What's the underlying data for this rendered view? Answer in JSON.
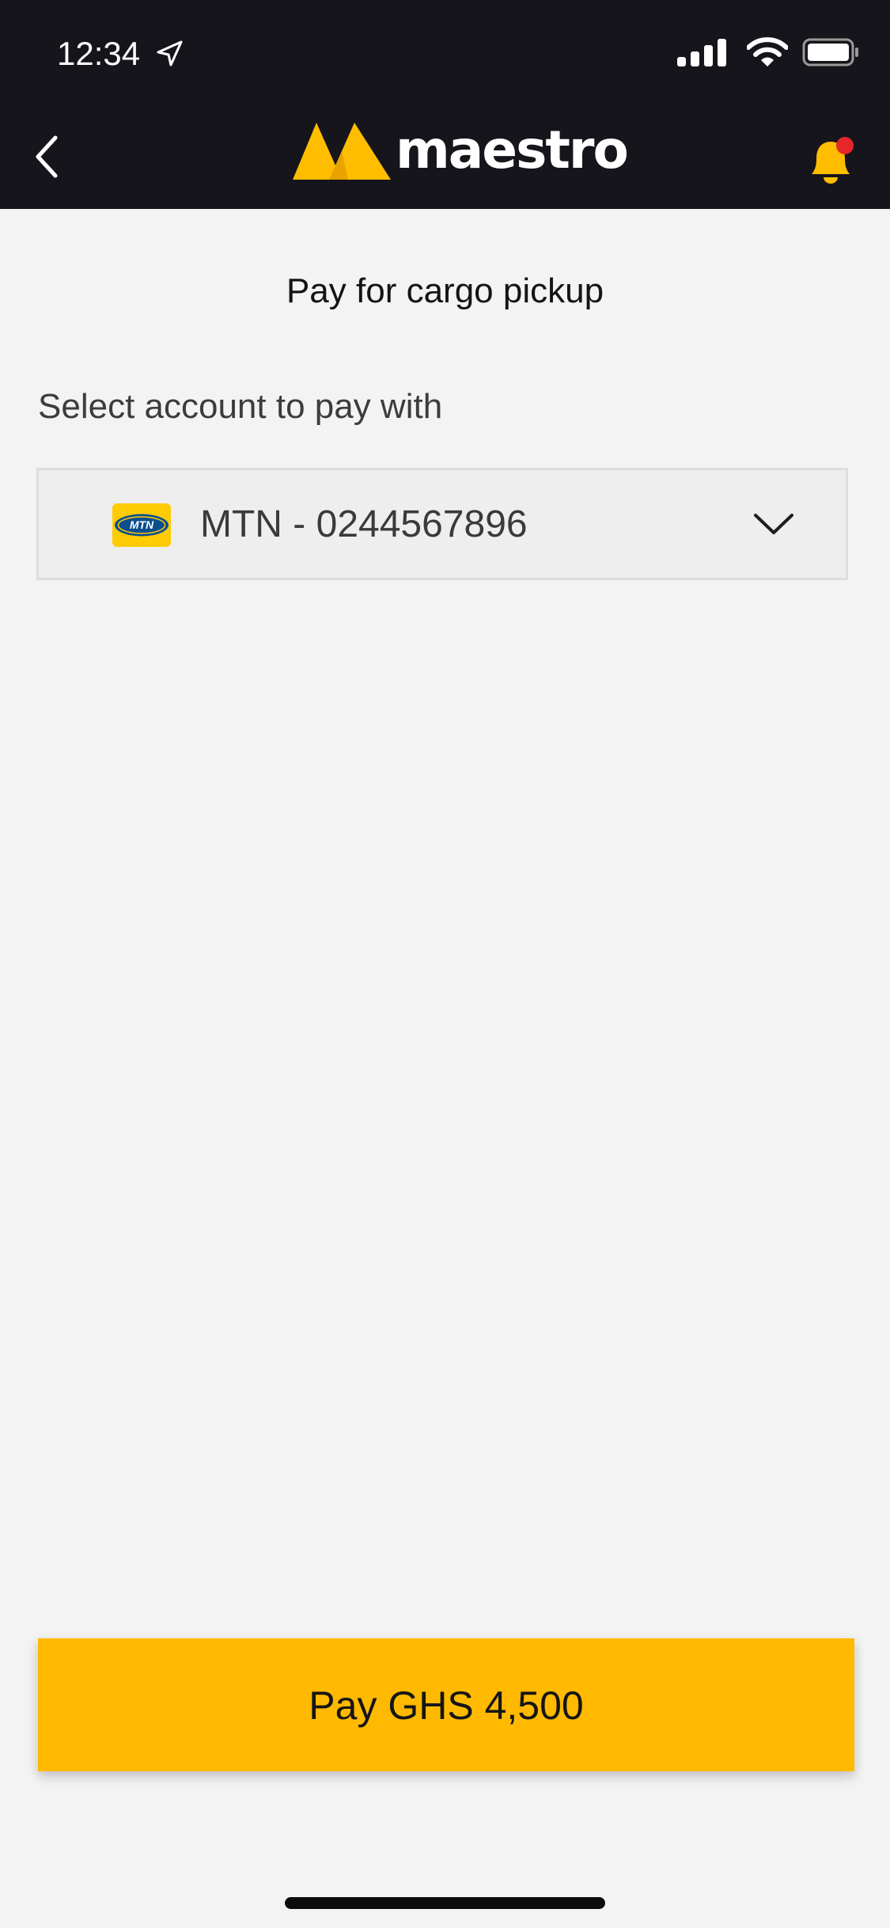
{
  "status_bar": {
    "time": "12:34",
    "icons": [
      "location-arrow-icon",
      "cellular-signal-icon",
      "wifi-icon",
      "battery-icon"
    ]
  },
  "nav": {
    "back_icon": "chevron-left-icon",
    "logo_text": "maestro",
    "bell_icon": "bell-icon",
    "has_notification_dot": true
  },
  "page": {
    "title": "Pay for cargo pickup",
    "account_label": "Select account to pay with"
  },
  "account_select": {
    "provider_logo_text": "MTN",
    "selected_value": "MTN - 0244567896",
    "dropdown_icon": "chevron-down-icon"
  },
  "pay_button": {
    "label": "Pay GHS 4,500"
  },
  "colors": {
    "header_bg": "#15151b",
    "page_bg": "#f3f3f3",
    "accent": "#ffb901",
    "notification_dot": "#e5262b",
    "mtn_yellow": "#ffcb05",
    "mtn_blue": "#0c4f8f"
  }
}
